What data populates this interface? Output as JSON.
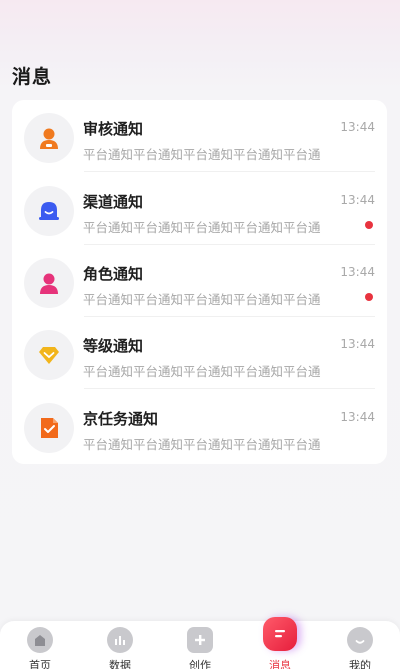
{
  "page": {
    "title": "消息"
  },
  "notifications": [
    {
      "title": "审核通知",
      "preview": "平台通知平台通知平台通知平台通知平台通",
      "time": "13:44",
      "unread": false,
      "icon": "user-icon",
      "color": "#f07a1f"
    },
    {
      "title": "渠道通知",
      "preview": "平台通知平台通知平台通知平台通知平台通",
      "time": "13:44",
      "unread": true,
      "icon": "bell-icon",
      "color": "#3b5bf0"
    },
    {
      "title": "角色通知",
      "preview": "平台通知平台通知平台通知平台通知平台通",
      "time": "13:44",
      "unread": true,
      "icon": "person-icon",
      "color": "#e6337a"
    },
    {
      "title": "等级通知",
      "preview": "平台通知平台通知平台通知平台通知平台通",
      "time": "13:44",
      "unread": false,
      "icon": "diamond-icon",
      "color": "#f2b51b"
    },
    {
      "title": "京任务通知",
      "preview": "平台通知平台通知平台通知平台通知平台通",
      "time": "13:44",
      "unread": false,
      "icon": "task-doc-icon",
      "color": "#f26a1b"
    }
  ],
  "tabbar": [
    {
      "label": "首页",
      "icon": "home-icon",
      "active": false
    },
    {
      "label": "数据",
      "icon": "chart-icon",
      "active": false
    },
    {
      "label": "创作",
      "icon": "plus-icon",
      "active": false
    },
    {
      "label": "消息",
      "icon": "message-icon",
      "active": true
    },
    {
      "label": "我的",
      "icon": "profile-icon",
      "active": false
    }
  ],
  "colors": {
    "accent": "#e8333f",
    "unread_dot": "#e8333f"
  }
}
